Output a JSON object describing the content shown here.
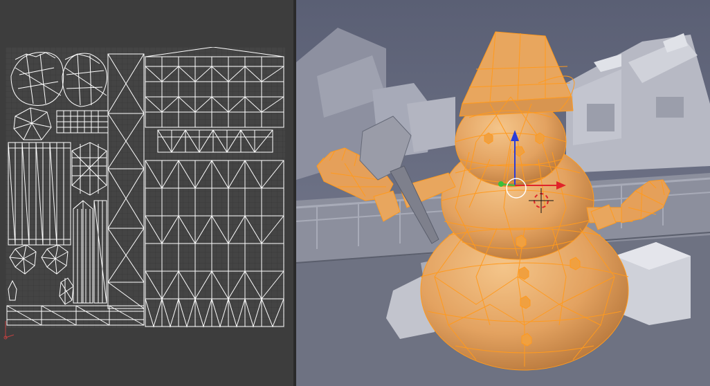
{
  "window": {
    "left_area": "uv-image-editor",
    "right_area": "3d-viewport"
  },
  "uv_editor": {
    "background": "#3d3d3d",
    "grid_bg": "#444444",
    "uv_edge_color": "#ffffff",
    "icons": [
      "uv-axis-icon"
    ]
  },
  "viewport": {
    "selected_object": "snowman",
    "selection_color": "#ff9a1e",
    "mesh_fill": "#e6a05a",
    "scene_gray": "#b8bac4",
    "gizmo": {
      "x_color": "#e0242a",
      "y_color": "#39c13a",
      "z_color": "#2a3cd8"
    },
    "icons": [
      "3d-cursor-icon",
      "transform-gizmo-icon",
      "pivot-circle-icon"
    ]
  }
}
